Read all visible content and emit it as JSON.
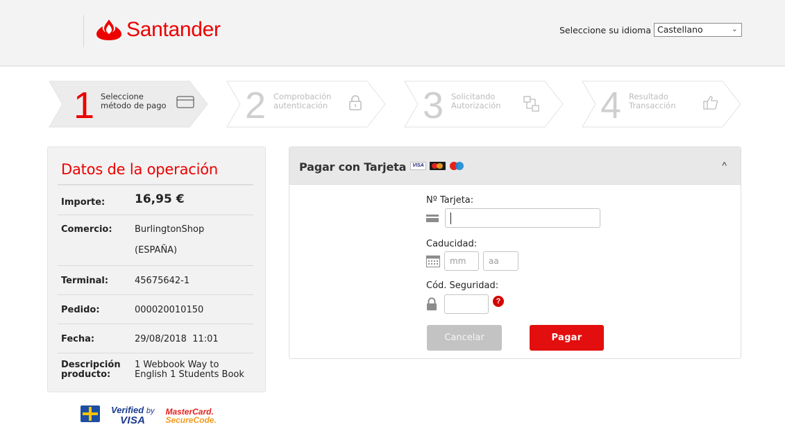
{
  "header": {
    "brand": "Santander",
    "language_label": "Seleccione su idioma",
    "language_selected": "Castellano"
  },
  "steps": [
    {
      "number": "1",
      "line1": "Seleccione",
      "line2": "método de pago",
      "state": "active",
      "icon": "credit-card-icon"
    },
    {
      "number": "2",
      "line1": "Comprobación",
      "line2": "autenticación",
      "state": "inactive",
      "icon": "lock-icon"
    },
    {
      "number": "3",
      "line1": "Solicitando",
      "line2": "Autorización",
      "state": "inactive",
      "icon": "network-icon"
    },
    {
      "number": "4",
      "line1": "Resultado",
      "line2": "Transacción",
      "state": "inactive",
      "icon": "thumbs-up-icon"
    }
  ],
  "operation": {
    "title": "Datos de la operación",
    "rows": [
      {
        "label": "Importe:",
        "value": "16,95 €"
      },
      {
        "label": "Comercio:",
        "value_line1": "BurlingtonShop",
        "value_line2": "(ESPAÑA)"
      },
      {
        "label": "Terminal:",
        "value": "45675642-1"
      },
      {
        "label": "Pedido:",
        "value": "000020010150"
      },
      {
        "label": "Fecha:",
        "value": "29/08/2018  11:01"
      },
      {
        "label_line1": "Descripción",
        "label_line2": "producto:",
        "value_line1": "1 Webbook Way to",
        "value_line2": "English 1 Students Book"
      }
    ]
  },
  "secure_logos": {
    "vbv_line1": "Verified",
    "vbv_by": "by",
    "vbv_line2": "VISA",
    "mc_line1": "MasterCard.",
    "mc_line2": "SecureCode."
  },
  "payment": {
    "title": "Pagar con Tarjeta",
    "card_visa": "VISA",
    "card_number_label": "Nº Tarjeta:",
    "card_number_value": "",
    "expiry_label": "Caducidad:",
    "month_placeholder": "mm",
    "year_placeholder": "aa",
    "cvv_label": "Cód. Seguridad:",
    "cvv_value": "",
    "help_symbol": "?",
    "cancel_label": "Cancelar",
    "pay_label": "Pagar",
    "collapse_symbol": "^"
  },
  "colors": {
    "brand_red": "#ec0000",
    "pay_button": "#e30e0e",
    "cancel_button": "#c3c3c3"
  }
}
